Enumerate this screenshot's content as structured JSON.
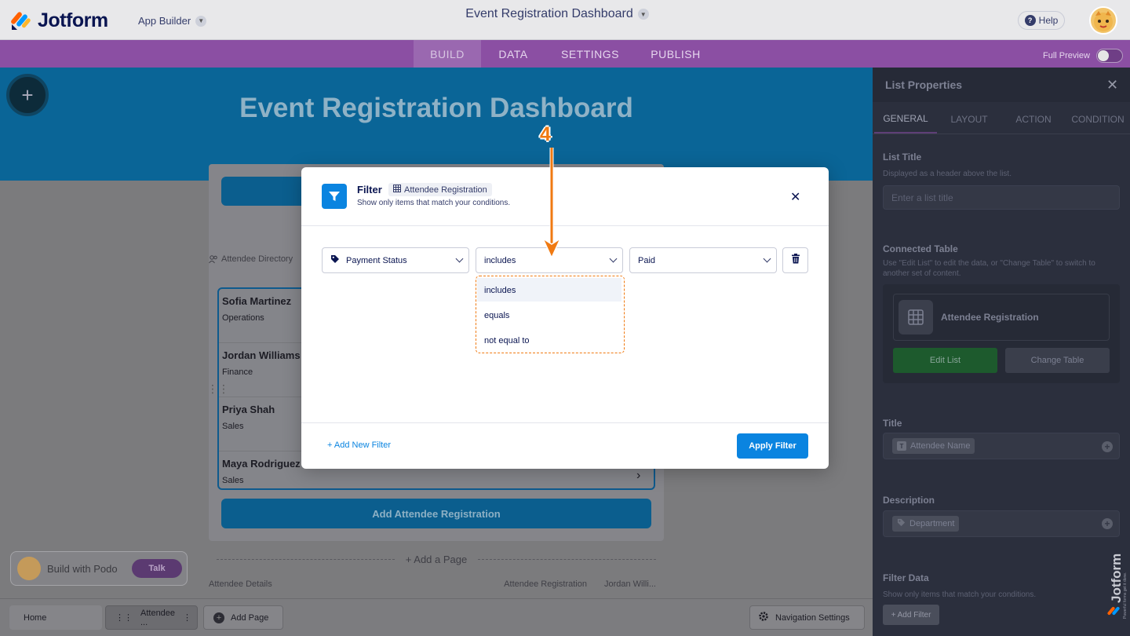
{
  "header": {
    "logo_text": "Jotform",
    "app_builder": "App Builder",
    "app_title": "Event Registration Dashboard",
    "help": "Help"
  },
  "tabs": [
    "BUILD",
    "DATA",
    "SETTINGS",
    "PUBLISH"
  ],
  "full_preview": "Full Preview",
  "canvas": {
    "hero_title": "Event Registration Dashboard",
    "directory_label": "Attendee Directory",
    "attendees": [
      {
        "name": "Sofia Martinez",
        "dept": "Operations"
      },
      {
        "name": "Jordan Williams",
        "dept": "Finance"
      },
      {
        "name": "Priya Shah",
        "dept": "Sales"
      },
      {
        "name": "Maya Rodriguez",
        "dept": "Sales"
      }
    ],
    "add_attendee_button": "Add Attendee Registration",
    "add_page": "+ Add a Page",
    "details_label": "Attendee Details",
    "details_table": "Attendee Registration",
    "details_record": "Jordan Willi...",
    "podo_label": "Build with Podo",
    "podo_talk": "Talk"
  },
  "bottom_nav": {
    "home": "Home",
    "attendee": "Attendee ...",
    "add_page": "Add Page",
    "nav_settings": "Navigation Settings"
  },
  "panel": {
    "title": "List Properties",
    "tabs": [
      "GENERAL",
      "LAYOUT",
      "ACTION",
      "CONDITION"
    ],
    "list_title": "List Title",
    "list_title_help": "Displayed as a header above the list.",
    "list_title_placeholder": "Enter a list title",
    "connected_table": "Connected Table",
    "connected_table_help": "Use \"Edit List\" to edit the data, or \"Change Table\" to switch to another set of content.",
    "table_name": "Attendee Registration",
    "edit_list": "Edit List",
    "change_table": "Change Table",
    "title_label": "Title",
    "title_field": "Attendee Name",
    "description_label": "Description",
    "description_field": "Department",
    "filter_data": "Filter Data",
    "filter_data_help": "Show only items that match your conditions.",
    "add_filter": "+ Add Filter",
    "watermark": "Jotform",
    "watermark_sub": "Powerful forms get it done."
  },
  "modal": {
    "title": "Filter",
    "table_chip": "Attendee Registration",
    "subtitle": "Show only items that match your conditions.",
    "field": "Payment Status",
    "operator": "includes",
    "value": "Paid",
    "options": [
      "includes",
      "equals",
      "not equal to"
    ],
    "add_new_filter": "+ Add New Filter",
    "apply": "Apply Filter"
  },
  "annotation": {
    "step": "4"
  },
  "colors": {
    "purple_bar": "#8b4fa3",
    "hero_blue": "#0a6597",
    "accent_blue": "#0a84e0",
    "annotation_orange": "#f07a12",
    "edit_green": "#1d5a2d"
  }
}
